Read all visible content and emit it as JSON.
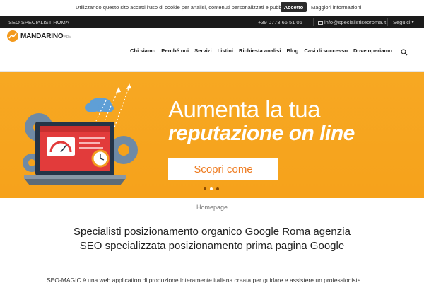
{
  "cookie_bar": {
    "text": "Utilizzando questo sito accetti l'uso di cookie per analisi, contenuti personalizzati e pubblicità.",
    "accept_label": "Accetto",
    "more_label": "Maggiori informazioni"
  },
  "topbar": {
    "site_label": "SEO SPECIALIST ROMA",
    "phone": "+39 0773 66 51 06",
    "email": "info@specialistiseoroma.it",
    "follow_label": "Seguici"
  },
  "header": {
    "logo_text": "MANDARINO",
    "logo_suffix": "ADV",
    "nav": [
      {
        "label": "Chi siamo"
      },
      {
        "label": "Perché noi"
      },
      {
        "label": "Servizi"
      },
      {
        "label": "Listini"
      },
      {
        "label": "Richiesta analisi"
      },
      {
        "label": "Blog"
      },
      {
        "label": "Casi di successo"
      },
      {
        "label": "Dove operiamo"
      }
    ]
  },
  "banner": {
    "title_line1": "Aumenta la tua",
    "title_line2": "reputazione on line",
    "cta_label": "Scopri come",
    "slides_total": 3,
    "active_slide": 1,
    "colors": {
      "background": "#f6a21b",
      "cta_text": "#ee7a1e"
    }
  },
  "breadcrumb": "Homepage",
  "headline": {
    "line1": "Specialisti posizionamento organico Google Roma agenzia",
    "line2": "SEO specializzata posizionamento prima pagina Google"
  },
  "intro": "SEO-MAGIC è una web application di produzione interamente italiana creata per guidare e assistere un professionista"
}
